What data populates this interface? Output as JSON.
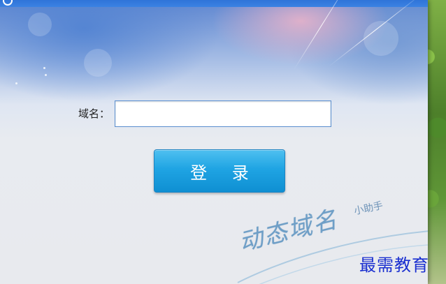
{
  "form": {
    "domain_label": "域名：",
    "domain_value": "",
    "login_button_label": "登 录"
  },
  "branding": {
    "main_text": "动态域名",
    "sub_text": "小助手"
  },
  "watermark": {
    "text": "最需教育"
  },
  "colors": {
    "titlebar": "#2f74d8",
    "login_button": "#1fa4e3",
    "input_border": "#5a8fd0",
    "corner_watermark": "#1a2fd0"
  },
  "icons": {
    "app_logo": "globe-logo-icon"
  }
}
